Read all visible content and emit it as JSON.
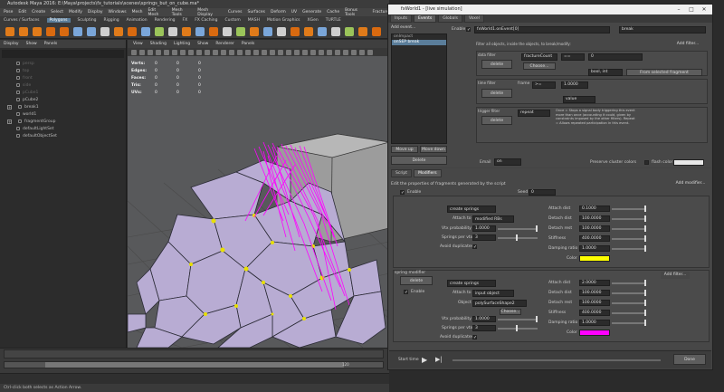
{
  "maya": {
    "title": "Autodesk Maya 2016: E:\\Maya\\projects\\fx_tutorials\\scenes\\springs_but_on_cube.ma*",
    "menu": [
      "Pose",
      "Edit",
      "Create",
      "Select",
      "Modify",
      "Display",
      "Windows",
      "Mesh",
      "Edit Mesh",
      "Mesh Tools",
      "Mesh Display",
      "Curves",
      "Surfaces",
      "Deform",
      "UV",
      "Generate",
      "Cache",
      "Bonus Tools",
      "Fracture"
    ],
    "shelf_tabs": [
      "Curves / Surfaces",
      "Polygons",
      "Sculpting",
      "Rigging",
      "Animation",
      "Rendering",
      "FX",
      "FX Caching",
      "Custom",
      "MASH",
      "Motion Graphics",
      "XGen",
      "TURTLE"
    ],
    "shelf_tab_active": "Polygons",
    "outliner": {
      "menu": [
        "Display",
        "Show",
        "Panels"
      ],
      "items": [
        {
          "label": "persp",
          "dim": true
        },
        {
          "label": "top",
          "dim": true
        },
        {
          "label": "front",
          "dim": true
        },
        {
          "label": "side",
          "dim": true
        },
        {
          "label": "pCube1",
          "dim": true
        },
        {
          "label": "pCube2",
          "dim": false
        },
        {
          "label": "break1",
          "dim": false,
          "expand": "+"
        },
        {
          "label": "world1",
          "dim": false
        },
        {
          "label": "fragmentGroup",
          "dim": false,
          "expand": "+"
        },
        {
          "label": "defaultLightSet",
          "dim": false
        },
        {
          "label": "defaultObjectSet",
          "dim": false
        }
      ]
    },
    "viewport": {
      "menu": [
        "View",
        "Shading",
        "Lighting",
        "Show",
        "Renderer",
        "Panels"
      ],
      "hud": [
        {
          "label": "Verts:",
          "a": "0",
          "b": "0",
          "c": "0"
        },
        {
          "label": "Edges:",
          "a": "0",
          "b": "0",
          "c": "0"
        },
        {
          "label": "Faces:",
          "a": "0",
          "b": "0",
          "c": "0"
        },
        {
          "label": "Tris:",
          "a": "0",
          "b": "0",
          "c": "0"
        },
        {
          "label": "UVs:",
          "a": "0",
          "b": "0",
          "c": "0"
        }
      ]
    },
    "timeline": {
      "range_end": "120"
    },
    "help_line": "Ctrl-click both selects as Action Arrow."
  },
  "fx": {
    "title": "fxWorld1 - [live simulation]",
    "tabs": [
      "Inputs",
      "Events",
      "Globals",
      "Voxel"
    ],
    "active_tab": "Events",
    "events": {
      "add_event": "Add event...",
      "list": [
        "onImpact",
        "onSEP break"
      ],
      "enable_label": "Enable",
      "event_name": "fxWorld1.onEvent[0]",
      "event_type": "break",
      "description": "Filter all objects, inside the objects, to break/modify:",
      "add_filter": "Add filter...",
      "data_filter": {
        "title": "data filter",
        "field": "fractureCount",
        "op": "==",
        "value": "0",
        "choose": "Choose...",
        "bool_type": "bool, int",
        "from_fragment": "From selected fragment"
      },
      "time_filter": {
        "title": "time filter",
        "frame_label": "frame",
        "op": ">=",
        "value": "1.0000",
        "mode": "value"
      },
      "trigger_filter": {
        "title": "trigger filter",
        "mode": "repeat",
        "help": "Once = Stops a signal body triggering this event more than once (accounting it could, given by constraints imposed by the other filters). Repeat = Allows repeated participation in this event."
      },
      "delete": "delete",
      "move_up": "Move up",
      "move_down": "Move down",
      "delete_event": "Delete",
      "email_label": "Email",
      "email_value": "on",
      "preserve_color": "Preserve cluster colors",
      "flash_color": "flash color"
    },
    "modifiers": {
      "tabs": [
        "Script",
        "Modifiers"
      ],
      "active_tab": "Modifiers",
      "description": "Edit the properties of fragments generated by the script",
      "add_modifier": "Add modifier...",
      "enable_seed": "Enable",
      "seed_label": "Seed",
      "seed_value": "0",
      "blocks": [
        {
          "title": "",
          "action": "create springs",
          "attach_to_label": "Attach to",
          "attach_to": "modified RBs",
          "object_label": "",
          "object_value": "",
          "vtx_prob_label": "Vtx probability",
          "vtx_prob": "1.0000",
          "springs_label": "Springs per vtx",
          "springs": "3",
          "avoid_label": "Avoid duplicates",
          "attach_dist_label": "Attach dist",
          "attach_dist": "0.1000",
          "detach_dist_label": "Detach dist",
          "detach_dist": "100.0000",
          "detach_rest_label": "Detach rest",
          "detach_rest": "100.0000",
          "stiffness_label": "Stiffness",
          "stiffness": "400.0000",
          "damping_label": "Damping ratio",
          "damping": "1.0000",
          "color_label": "Color",
          "color": "#ffff00"
        },
        {
          "title": "spring modifier",
          "action": "create springs",
          "attach_to_label": "Attach to",
          "attach_to": "input object",
          "object_label": "Object",
          "object_value": "polySurfaceShape2",
          "choose": "Choose...",
          "vtx_prob_label": "Vtx probability",
          "vtx_prob": "1.0000",
          "springs_label": "Springs per vtx",
          "springs": "3",
          "avoid_label": "Avoid duplicates",
          "attach_dist_label": "Attach dist",
          "attach_dist": "2.0000",
          "detach_dist_label": "Detach dist",
          "detach_dist": "100.0000",
          "detach_rest_label": "Detach rest",
          "detach_rest": "100.0000",
          "stiffness_label": "Stiffness",
          "stiffness": "400.0000",
          "damping_label": "Damping ratio",
          "damping": "1.0000",
          "color_label": "Color",
          "color": "#ff00ff"
        }
      ],
      "add_filter": "Add filter..."
    },
    "bottom": {
      "start_time": "Start time",
      "done": "Done"
    }
  },
  "colors": {
    "accent": "#5a7d9a",
    "spring_magenta": "#ff00ff",
    "spring_yellow": "#ffff00",
    "fragment": "#b8acd3"
  }
}
